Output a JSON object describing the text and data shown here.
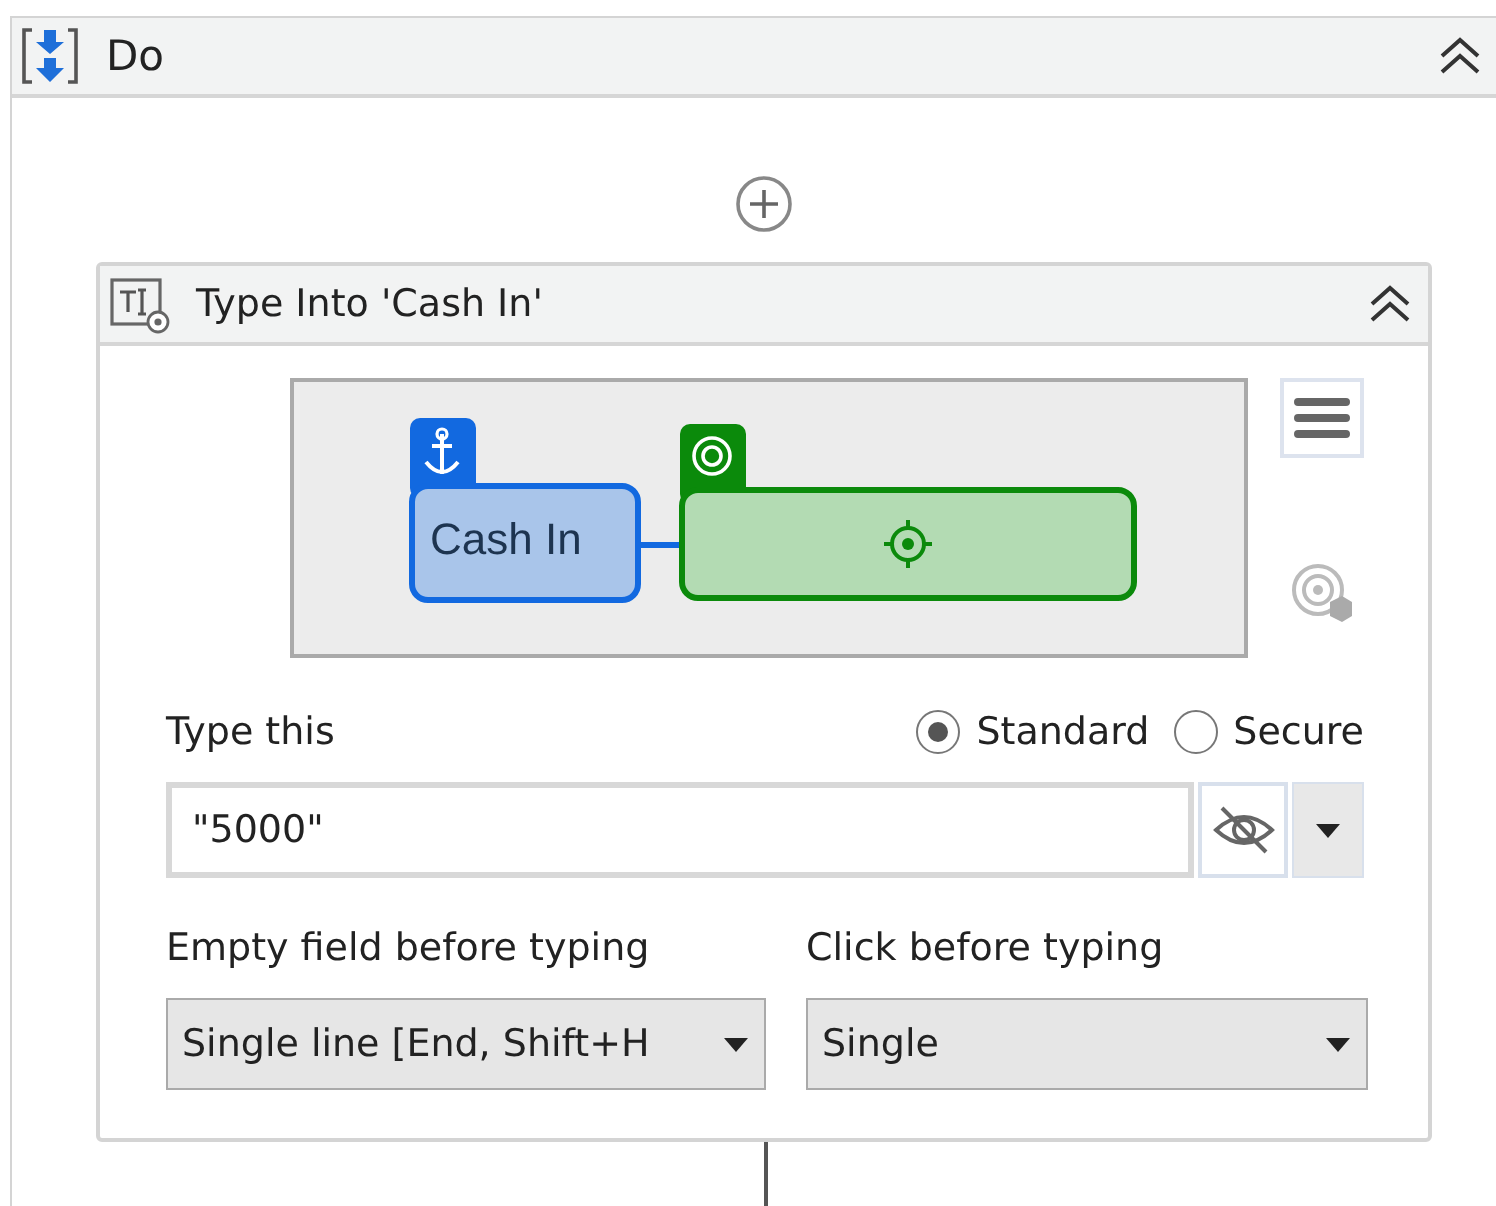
{
  "sequence": {
    "title": "Do",
    "expanded": true
  },
  "activity": {
    "title": "Type Into 'Cash In'",
    "expanded": true,
    "preview": {
      "anchor_label": "Cash In"
    },
    "type_this": {
      "label": "Type this",
      "value": "\"5000\"",
      "masked": false
    },
    "modes": [
      {
        "label": "Standard",
        "selected": true
      },
      {
        "label": "Secure",
        "selected": false
      }
    ],
    "empty_field": {
      "label": "Empty field before typing",
      "value": "Single line [End, Shift+H"
    },
    "click": {
      "label": "Click before typing",
      "value": "Single"
    }
  }
}
